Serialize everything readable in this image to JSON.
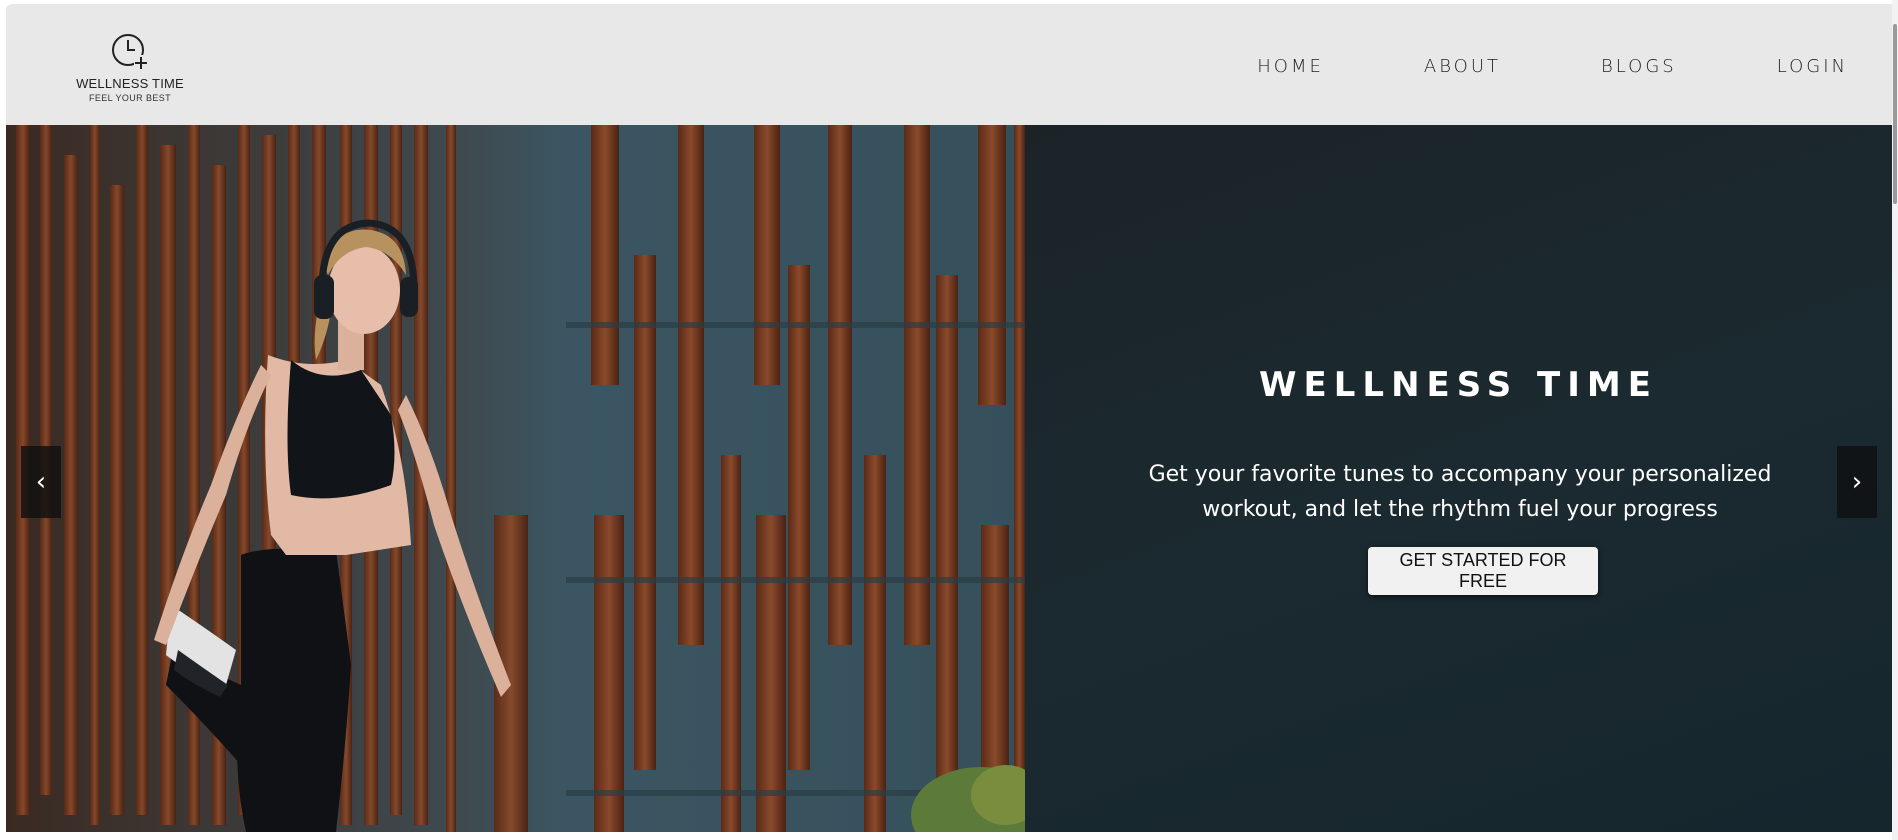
{
  "header": {
    "logo": {
      "icon": "clock-plus-icon",
      "title": "WELLNESS TIME",
      "tagline": "FEEL YOUR BEST"
    },
    "nav": [
      {
        "label": "HOME"
      },
      {
        "label": "ABOUT"
      },
      {
        "label": "BLOGS"
      },
      {
        "label": "LOGIN"
      }
    ]
  },
  "hero": {
    "image": "woman-stretching-with-headphones-photo",
    "title": "WELLNESS TIME",
    "text": "Get your favorite tunes to accompany your personalized workout, and let the rhythm fuel your progress",
    "cta_label": "GET STARTED FOR FREE",
    "prev_label": "‹",
    "next_label": "›"
  },
  "colors": {
    "header_bg": "#e8e8e8",
    "panel_bg": "#1b2a30",
    "button_bg": "#f1f1f1",
    "text_light": "#ffffff"
  }
}
